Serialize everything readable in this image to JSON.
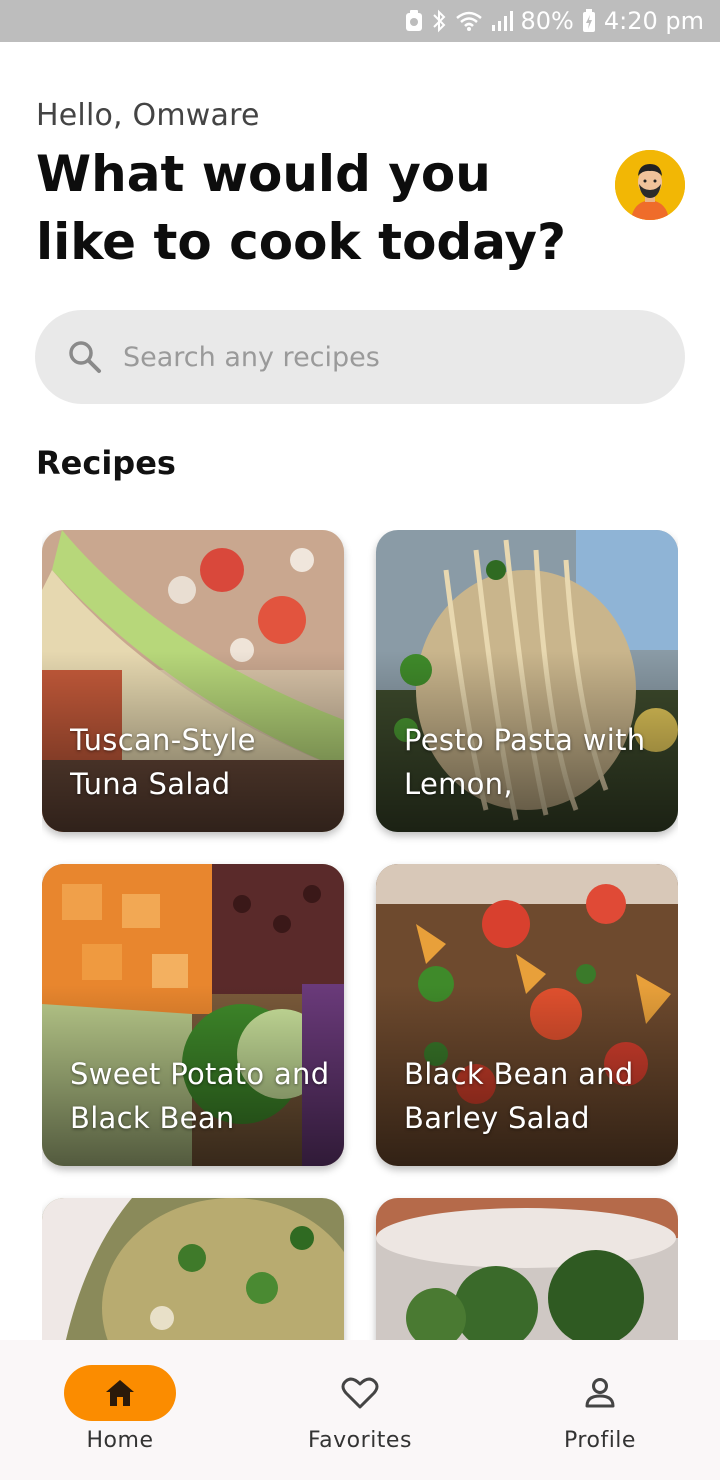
{
  "status_bar": {
    "battery": "80%",
    "time": "4:20 pm",
    "icons": [
      "sync-icon",
      "bluetooth-icon",
      "wifi-icon",
      "signal-icon",
      "battery-charging-icon"
    ]
  },
  "header": {
    "greeting": "Hello, Omware",
    "headline": "What would you like to cook today?"
  },
  "search": {
    "placeholder": "Search any recipes"
  },
  "section": {
    "title": "Recipes"
  },
  "recipes": [
    {
      "title": "Tuscan-Style Tuna Salad"
    },
    {
      "title": "Pesto Pasta with Lemon,"
    },
    {
      "title": "Sweet Potato and Black Bean"
    },
    {
      "title": "Black Bean and Barley Salad"
    },
    {
      "title": ""
    },
    {
      "title": ""
    }
  ],
  "nav": {
    "items": [
      {
        "label": "Home",
        "icon": "home-icon",
        "active": true
      },
      {
        "label": "Favorites",
        "icon": "heart-icon",
        "active": false
      },
      {
        "label": "Profile",
        "icon": "person-icon",
        "active": false
      }
    ]
  },
  "colors": {
    "accent": "#fb8c00",
    "avatar_bg": "#f2b705",
    "search_bg": "#e9e9e9"
  }
}
